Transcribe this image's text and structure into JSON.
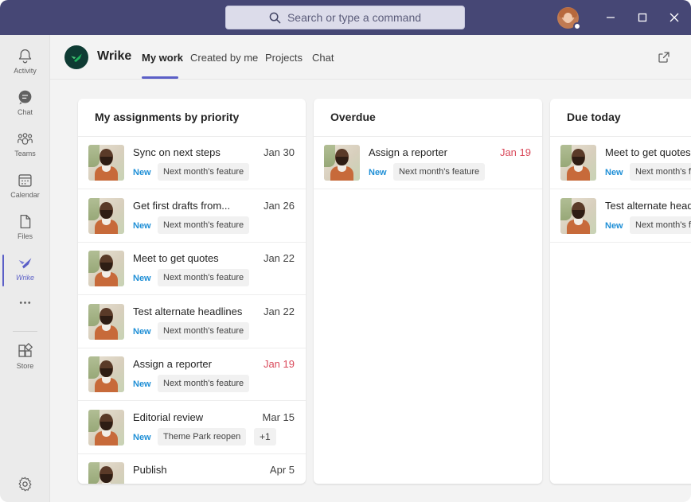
{
  "search": {
    "placeholder": "Search or type a command"
  },
  "rail": {
    "items": [
      {
        "label": "Activity"
      },
      {
        "label": "Chat"
      },
      {
        "label": "Teams"
      },
      {
        "label": "Calendar"
      },
      {
        "label": "Files"
      },
      {
        "label": "Wrike"
      },
      {
        "label": "Store"
      }
    ]
  },
  "app": {
    "name": "Wrike",
    "tabs": [
      {
        "label": "My work"
      },
      {
        "label": "Created by me"
      },
      {
        "label": "Projects"
      },
      {
        "label": "Chat"
      }
    ]
  },
  "columns": [
    {
      "title": "My assignments by priority",
      "rows": [
        {
          "title": "Sync on next steps",
          "date": "Jan 30",
          "status": "New",
          "tag": "Next month's feature"
        },
        {
          "title": "Get first drafts from...",
          "date": "Jan 26",
          "status": "New",
          "tag": "Next month's feature"
        },
        {
          "title": "Meet to get quotes",
          "date": "Jan 22",
          "status": "New",
          "tag": "Next month's feature"
        },
        {
          "title": "Test alternate headlines",
          "date": "Jan 22",
          "status": "New",
          "tag": "Next month's feature"
        },
        {
          "title": "Assign a reporter",
          "date": "Jan 19",
          "status": "New",
          "tag": "Next month's feature",
          "overdue": true
        },
        {
          "title": "Editorial review",
          "date": "Mar 15",
          "status": "New",
          "tag": "Theme Park reopen",
          "more": "+1"
        },
        {
          "title": "Publish",
          "date": "Apr 5",
          "status": "",
          "tag": ""
        }
      ]
    },
    {
      "title": "Overdue",
      "rows": [
        {
          "title": "Assign a reporter",
          "date": "Jan 19",
          "status": "New",
          "tag": "Next month's feature",
          "overdue": true
        }
      ]
    },
    {
      "title": "Due today",
      "rows": [
        {
          "title": "Meet to get quotes",
          "status": "New",
          "tag": "Next month's feature"
        },
        {
          "title": "Test alternate headlines",
          "status": "New",
          "tag": "Next month's feature"
        }
      ]
    }
  ],
  "colors": {
    "titlebar": "#464775",
    "accent": "#5b5fc7",
    "overdue": "#d94a5b",
    "status_new": "#1f8fd6",
    "wrike_logo": "#0e3b33"
  }
}
